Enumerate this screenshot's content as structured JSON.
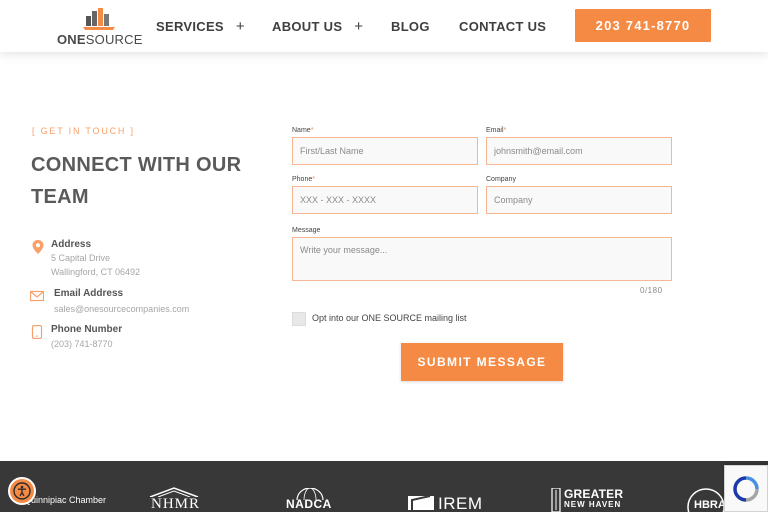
{
  "header": {
    "logo": {
      "bold": "ONE",
      "regular": "SOURCE"
    },
    "nav": [
      {
        "label": "SERVICES",
        "plus": "+"
      },
      {
        "label": "ABOUT US",
        "plus": "+"
      },
      {
        "label": "BLOG"
      },
      {
        "label": "CONTACT US"
      }
    ],
    "phone_button": "203 741-8770"
  },
  "contact": {
    "eyebrow": "[ GET IN TOUCH ]",
    "headline": "CONNECT WITH OUR TEAM",
    "address": {
      "label": "Address",
      "line1": "5 Capital Drive",
      "line2": "Wallingford, CT 06492",
      "icon": "location-pin-icon"
    },
    "email": {
      "label": "Email Address",
      "value": "sales@onesourcecompanies.com",
      "icon": "envelope-icon"
    },
    "phone": {
      "label": "Phone Number",
      "value": "(203) 741-8770",
      "icon": "phone-icon"
    }
  },
  "form": {
    "name": {
      "label": "Name",
      "required": "*",
      "placeholder": "First/Last Name"
    },
    "email": {
      "label": "Email",
      "required": "*",
      "placeholder": "johnsmith@email.com"
    },
    "phone": {
      "label": "Phone",
      "required": "*",
      "placeholder": "XXX - XXX - XXXX"
    },
    "company": {
      "label": "Company",
      "placeholder": "Company"
    },
    "message": {
      "label": "Message",
      "placeholder": "Write your message...",
      "counter": "0/180"
    },
    "optin_label": "Opt into our ONE SOURCE mailing list",
    "submit_label": "SUBMIT MESSAGE"
  },
  "footer": {
    "partners": [
      {
        "name": "Quinnipiac Chamber"
      },
      {
        "name": "NHMR"
      },
      {
        "name": "NADCA"
      },
      {
        "name": "IREM"
      },
      {
        "name": "GREATER",
        "sub": "NEW HAVEN"
      },
      {
        "name": "HBRA"
      }
    ]
  },
  "colors": {
    "accent": "#f58a45",
    "footer_bg": "#383838",
    "heading": "#5a5a5a"
  }
}
